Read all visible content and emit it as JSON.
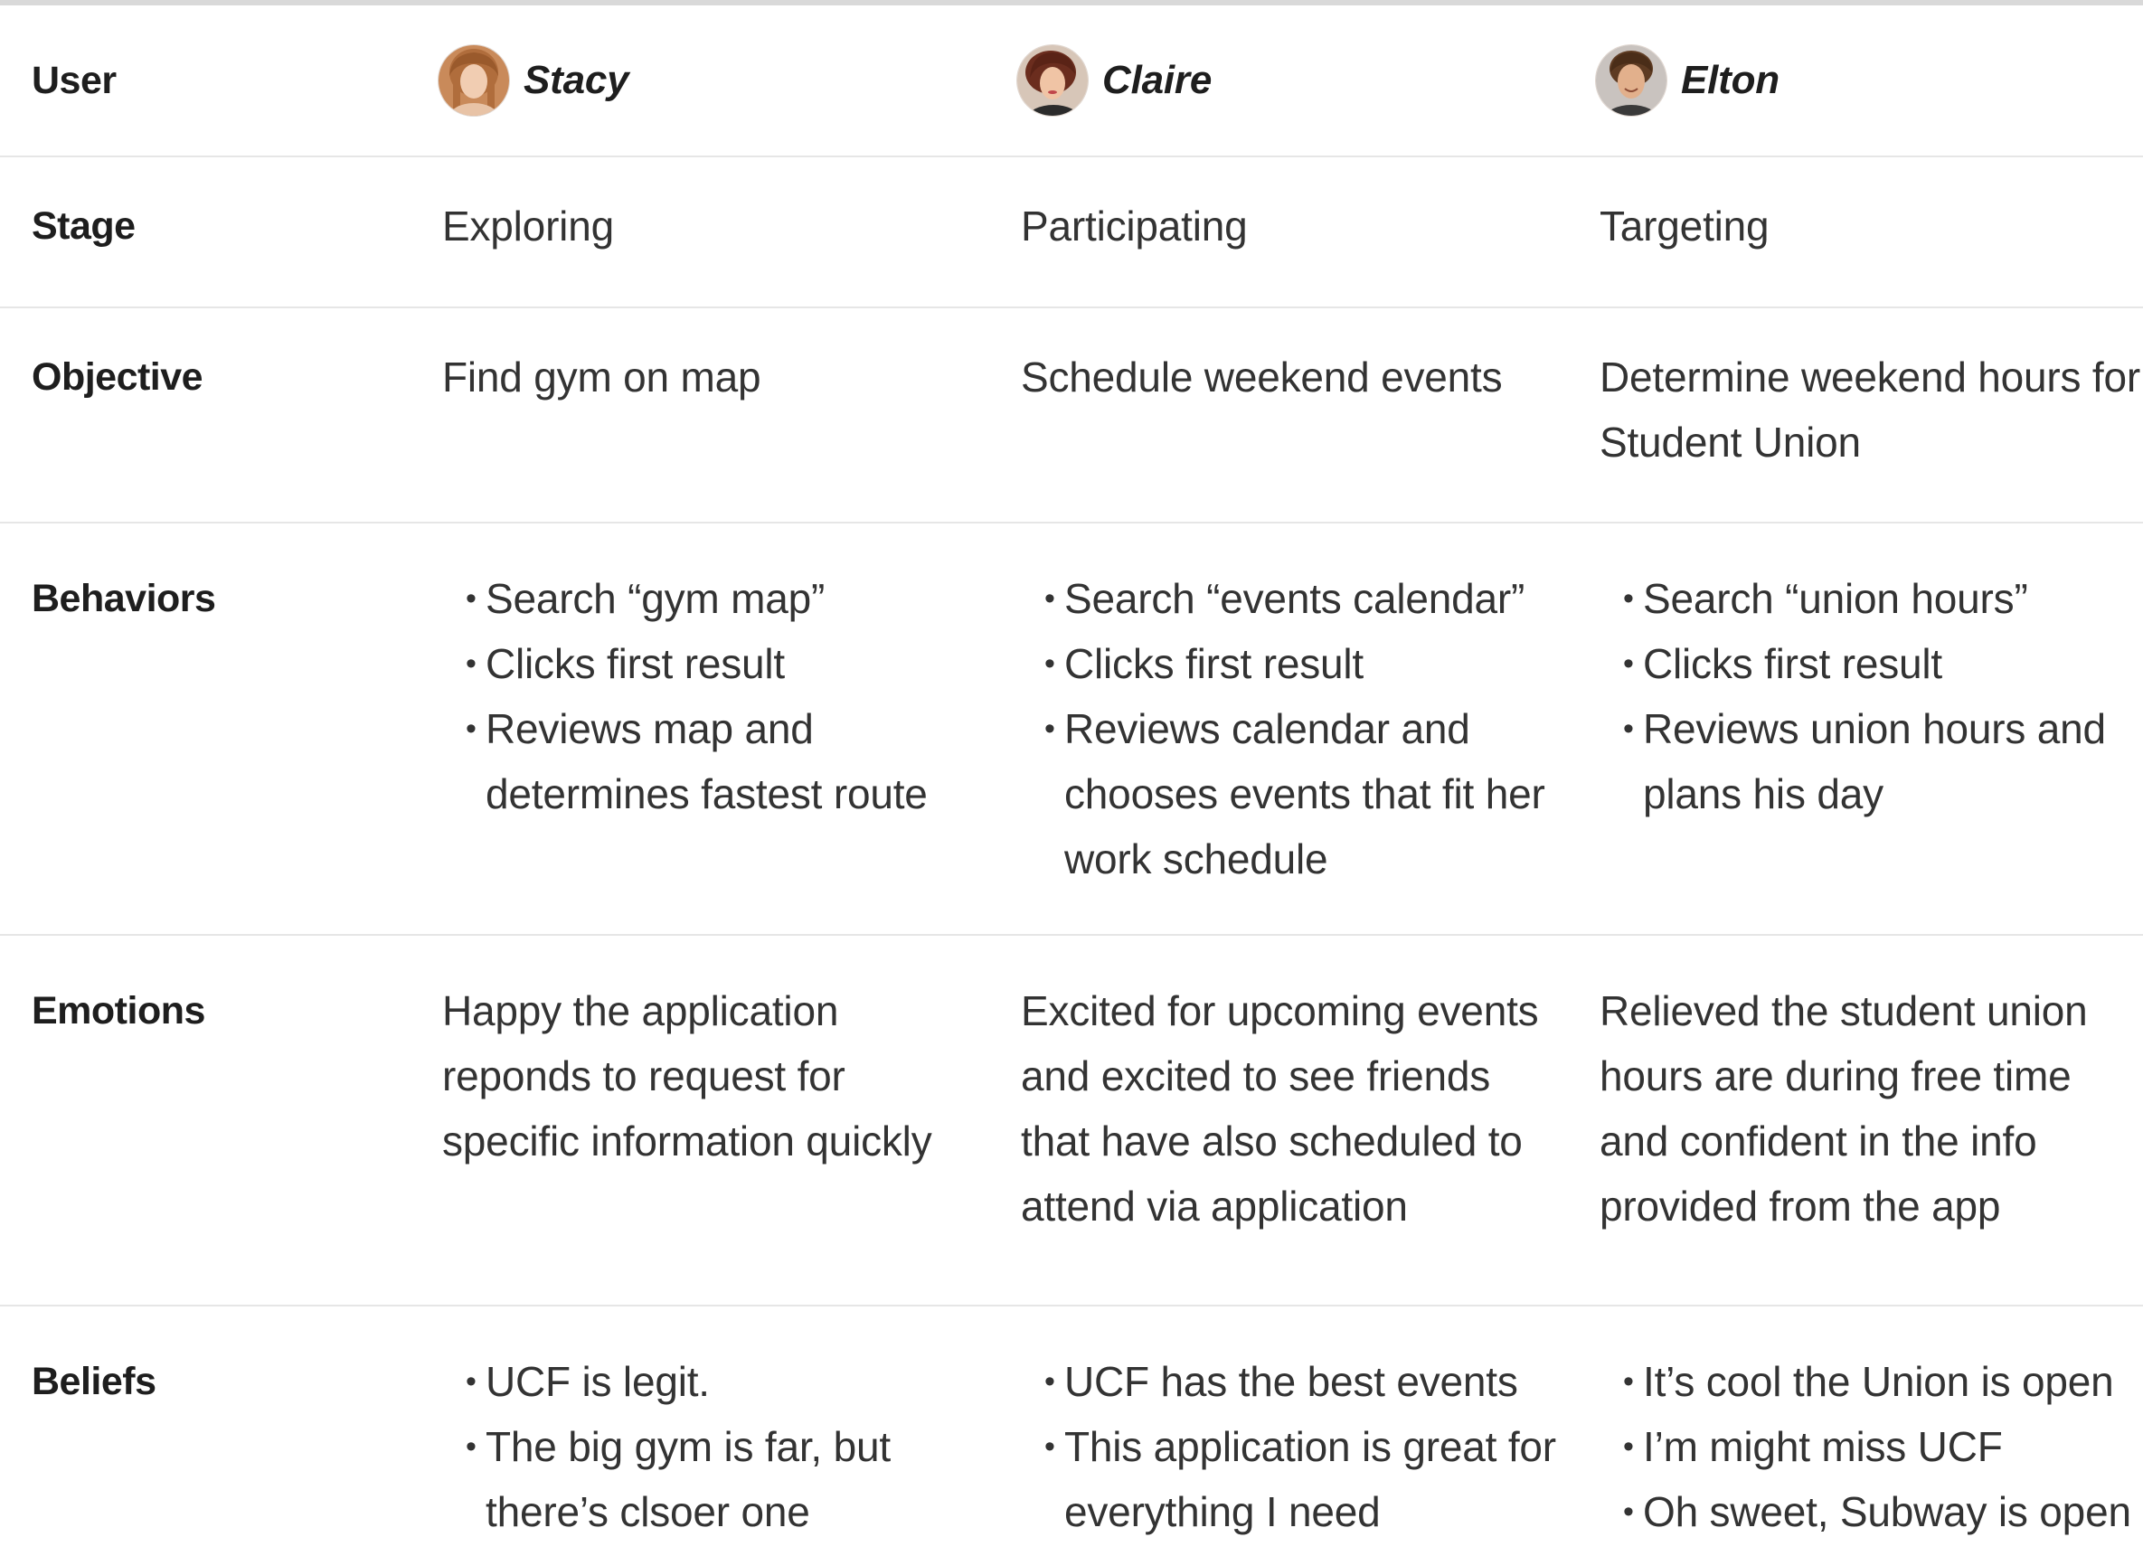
{
  "row_labels": {
    "user": "User",
    "stage": "Stage",
    "objective": "Objective",
    "behaviors": "Behaviors",
    "emotions": "Emotions",
    "beliefs": "Beliefs"
  },
  "users": [
    {
      "name": "Stacy",
      "avatar_icon": "person-avatar-female-light-hair",
      "stage": "Exploring",
      "objective": "Find gym on map",
      "behaviors": [
        "Search “gym map”",
        "Clicks first result",
        "Reviews map and determines fastest route"
      ],
      "emotions": "Happy the application reponds to request for specific information quickly",
      "beliefs": [
        "UCF is legit.",
        "The big gym is far, but there’s clsoer one"
      ]
    },
    {
      "name": "Claire",
      "avatar_icon": "person-avatar-female-dark-hair",
      "stage": "Participating",
      "objective": "Schedule weekend events",
      "behaviors": [
        "Search “events calendar”",
        "Clicks first result",
        "Reviews calendar and chooses events that fit her work schedule"
      ],
      "emotions": "Excited for upcoming events and excited to see friends that have also scheduled to attend via application",
      "beliefs": [
        "UCF has the best events",
        "This application is great for everything I need"
      ]
    },
    {
      "name": "Elton",
      "avatar_icon": "person-avatar-male",
      "stage": "Targeting",
      "objective": "Determine weekend hours for Student Union",
      "behaviors": [
        "Search “union hours”",
        "Clicks first result",
        "Reviews union hours and plans his day"
      ],
      "emotions": "Relieved the student union hours are during free time and confident in the info provided from the app",
      "beliefs": [
        "It’s cool the Union is open",
        "I’m might miss UCF",
        "Oh sweet, Subway is open"
      ]
    }
  ],
  "colors": {
    "label_text": "#1e1e1e",
    "body_text": "#333333",
    "row_divider": "#e6e6e6",
    "top_border": "#d9d9d9"
  }
}
